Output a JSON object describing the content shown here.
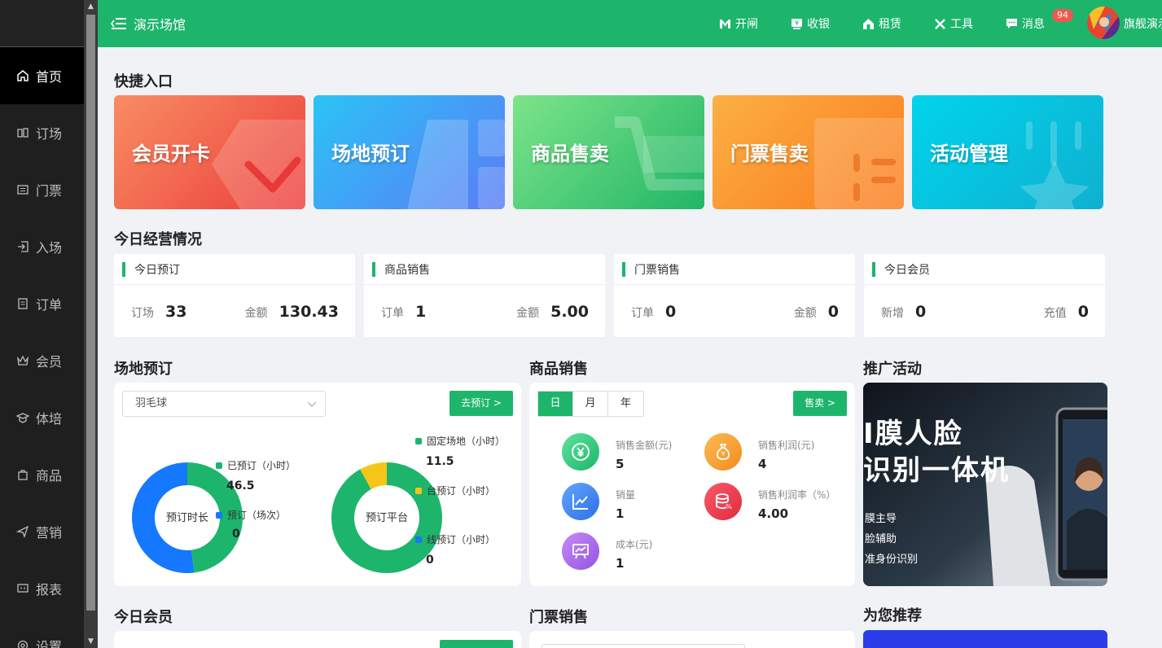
{
  "topbar": {
    "venue_name": "演示场馆",
    "actions": [
      {
        "label": "开闸",
        "icon": "gate-icon"
      },
      {
        "label": "收银",
        "icon": "cashier-icon"
      },
      {
        "label": "租赁",
        "icon": "rental-icon"
      },
      {
        "label": "工具",
        "icon": "tools-icon"
      },
      {
        "label": "消息",
        "icon": "message-icon"
      }
    ],
    "message_badge": "94",
    "user_name": "旗舰演示"
  },
  "sidebar": {
    "items": [
      {
        "label": "首页",
        "icon": "home-icon",
        "active": true
      },
      {
        "label": "订场",
        "icon": "booking-icon"
      },
      {
        "label": "门票",
        "icon": "ticket-icon"
      },
      {
        "label": "入场",
        "icon": "entry-icon"
      },
      {
        "label": "订单",
        "icon": "order-icon"
      },
      {
        "label": "会员",
        "icon": "member-icon"
      },
      {
        "label": "体培",
        "icon": "training-icon"
      },
      {
        "label": "商品",
        "icon": "goods-icon"
      },
      {
        "label": "营销",
        "icon": "marketing-icon"
      },
      {
        "label": "报表",
        "icon": "report-icon"
      },
      {
        "label": "设置",
        "icon": "settings-icon"
      }
    ]
  },
  "quick_entry": {
    "title": "快捷入口",
    "cards": [
      {
        "label": "会员开卡",
        "colors": [
          "#f88d63",
          "#ec3e3b"
        ]
      },
      {
        "label": "场地预订",
        "colors": [
          "#2bc4f5",
          "#5a7cf7"
        ]
      },
      {
        "label": "商品售卖",
        "colors": [
          "#7de48a",
          "#21b666"
        ]
      },
      {
        "label": "门票售卖",
        "colors": [
          "#fbb044",
          "#fb7b1c"
        ]
      },
      {
        "label": "活动管理",
        "colors": [
          "#00d4ec",
          "#0fb0d0"
        ]
      }
    ]
  },
  "today": {
    "title": "今日经营情况",
    "stats": [
      {
        "title": "今日预订",
        "left_label": "订场",
        "left_value": "33",
        "right_label": "金额",
        "right_value": "130.43"
      },
      {
        "title": "商品销售",
        "left_label": "订单",
        "left_value": "1",
        "right_label": "金额",
        "right_value": "5.00"
      },
      {
        "title": "门票销售",
        "left_label": "订单",
        "left_value": "0",
        "right_label": "金额",
        "right_value": "0"
      },
      {
        "title": "今日会员",
        "left_label": "新增",
        "left_value": "0",
        "right_label": "充值",
        "right_value": "0"
      }
    ]
  },
  "venue_booking": {
    "title": "场地预订",
    "select_value": "羽毛球",
    "go_button": "去预订 >",
    "donut1": {
      "center": "预订时长",
      "legend": [
        {
          "label": "已预订（小时）",
          "value": "46.5",
          "color": "#1db56c",
          "fraction": 0.48
        },
        {
          "label": "预订（场次）",
          "value": "0",
          "color": "#1677ff",
          "fraction": 0.52
        }
      ]
    },
    "donut2": {
      "center": "预订平台",
      "legend": [
        {
          "label": "固定场地（小时）",
          "value": "11.5",
          "color": "#1db56c",
          "fraction": 0.92
        },
        {
          "label": "台预订（小时）",
          "value": "",
          "color": "#f5c518",
          "fraction": 0.08
        },
        {
          "label": "线预订（小时）",
          "value": "0",
          "color": "#1677ff",
          "fraction": 0
        }
      ]
    }
  },
  "goods_sales": {
    "title": "商品销售",
    "tabs": [
      "日",
      "月",
      "年"
    ],
    "active_tab": "日",
    "sell_button": "售卖 >",
    "metrics": [
      {
        "label": "销售金额(元)",
        "value": "5",
        "icon": "yen-icon",
        "color": "#1db56c"
      },
      {
        "label": "销售利润(元)",
        "value": "4",
        "icon": "moneybag-icon",
        "color": "#f89b2c"
      },
      {
        "label": "销量",
        "value": "1",
        "icon": "chart-line-icon",
        "color": "#3d7ff0"
      },
      {
        "label": "销售利润率（%）",
        "value": "4.00",
        "icon": "database-icon",
        "color": "#f0384a"
      },
      {
        "label": "成本(元)",
        "value": "1",
        "icon": "presentation-icon",
        "color": "#a866e8"
      }
    ]
  },
  "promotion": {
    "title": "推广活动",
    "headline1": "I膜人脸",
    "headline2": "识别一体机",
    "bullets": [
      "膜主导",
      "脸辅助",
      "准身份识别"
    ]
  },
  "bottom": {
    "members_title": "今日会员",
    "tickets_title": "门票销售",
    "recommend_title": "为您推荐"
  }
}
